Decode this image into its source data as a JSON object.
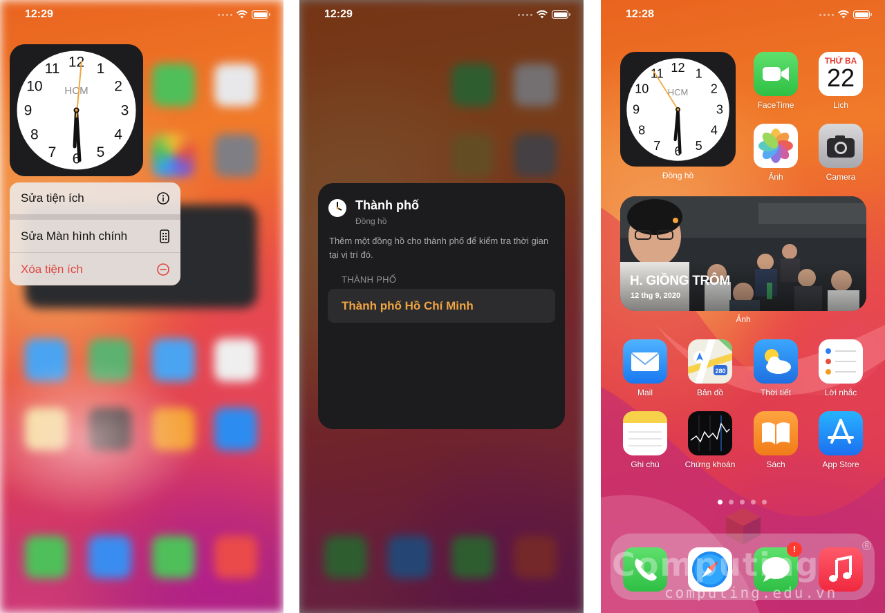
{
  "status_bar": [
    {
      "time": "12:29"
    },
    {
      "time": "12:29"
    },
    {
      "time": "12:28"
    }
  ],
  "clock": {
    "city_abbr": "HCM",
    "numerals": [
      "12",
      "1",
      "2",
      "3",
      "4",
      "5",
      "6",
      "7",
      "8",
      "9",
      "10",
      "11"
    ]
  },
  "context_menu": {
    "edit_widget": "Sửa tiện ích",
    "edit_home": "Sửa Màn hình chính",
    "remove_widget": "Xóa tiện ích"
  },
  "edit_card": {
    "title": "Thành phố",
    "subtitle": "Đồng hồ",
    "description": "Thêm một đồng hồ cho thành phố để kiểm tra thời gian tại vị trí đó.",
    "section": "THÀNH PHỐ",
    "value": "Thành phố Hồ Chí Minh"
  },
  "home": {
    "clock_label": "Đồng hồ",
    "calendar": {
      "weekday": "THỨ BA",
      "day": "22"
    },
    "apps_top": [
      {
        "name": "FaceTime"
      },
      {
        "name": "Lịch"
      },
      {
        "name": "Ảnh"
      },
      {
        "name": "Camera"
      }
    ],
    "photo_widget": {
      "title": "H. GIỒNG TRÔM",
      "date": "12 thg 9, 2020",
      "label": "Ảnh"
    },
    "apps_row1": [
      {
        "name": "Mail"
      },
      {
        "name": "Bản đồ"
      },
      {
        "name": "Thời tiết"
      },
      {
        "name": "Lời nhắc"
      }
    ],
    "apps_row2": [
      {
        "name": "Ghi chú"
      },
      {
        "name": "Chứng khoán"
      },
      {
        "name": "Sách"
      },
      {
        "name": "App Store"
      }
    ],
    "maps_shield": "280",
    "message_badge": "!",
    "watermark": {
      "brand": "Computing",
      "url": "computing.edu.vn",
      "reg": "®"
    }
  },
  "colors": {
    "accent_orange": "#f0a442",
    "danger_red": "#e0443e",
    "card_bg": "#1c1c1e"
  }
}
